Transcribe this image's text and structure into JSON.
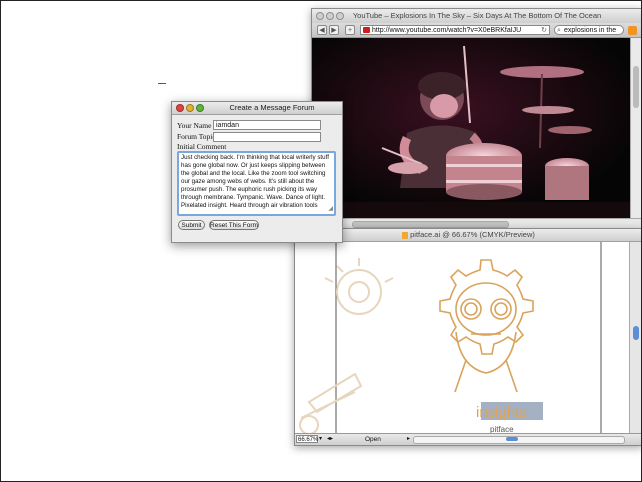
{
  "browser": {
    "window_title": "YouTube – Explosions In The Sky – Six Days At The Bottom Of The Ocean",
    "url": "http://www.youtube.com/watch?v=X0eBRKfaIJU",
    "search_text": "explosions in the",
    "back_icon": "back-arrow-icon",
    "forward_icon": "forward-arrow-icon",
    "add_icon": "plus-icon"
  },
  "illustrator": {
    "window_title": "pitface.ai @ 66.67% (CMYK/Preview)",
    "zoom": "66.67%",
    "status_field": "Open",
    "artwork_label": "insights",
    "below_label": "pitface"
  },
  "dialog": {
    "title": "Create a Message Forum",
    "your_name_label": "Your Name",
    "your_name_value": "iamdan",
    "forum_topic_label": "Forum Topic",
    "forum_topic_value": "",
    "initial_comment_label": "Initial Comment",
    "initial_comment_text": "Just checking back. I'm thinking that local writerly stuff has gone global now. Or just keeps slipping between the global and the local. Like the zoom tool switching our gaze among webs of webs. It's still about the prosumer push. The euphoric rush picking its way through membrane. Tympanic. Wave. Dance of light. Pixelated insight. Heard through air vibration tools",
    "submit_label": "Submit",
    "reset_label": "Reset This Form"
  },
  "colors": {
    "artwork_stroke": "#d9a35c",
    "insights_bg": "#a4b1c2",
    "insights_text": "#e6a14e",
    "accent_blue": "#5d8fd6"
  }
}
